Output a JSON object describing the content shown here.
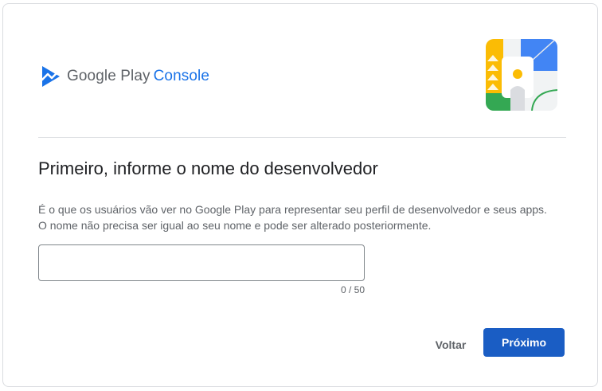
{
  "header": {
    "logo_brand": "Google Play",
    "logo_product": "Console",
    "logo_icon": "play-console-icon",
    "illustration_icon": "developer-profile-illustration"
  },
  "main": {
    "title": "Primeiro, informe o nome do desenvolvedor",
    "description": "É o que os usuários vão ver no Google Play para representar seu perfil de desenvolvedor e seus apps. O nome não precisa ser igual ao seu nome e pode ser alterado posteriormente.",
    "developer_name": {
      "value": "",
      "placeholder": "",
      "counter": "0 / 50"
    }
  },
  "actions": {
    "back_label": "Voltar",
    "next_label": "Próximo"
  },
  "colors": {
    "accent": "#1a73e8",
    "primary_button": "#1a5dc4",
    "text_secondary": "#5f6368",
    "text_primary": "#202124",
    "border": "#dadce0"
  }
}
